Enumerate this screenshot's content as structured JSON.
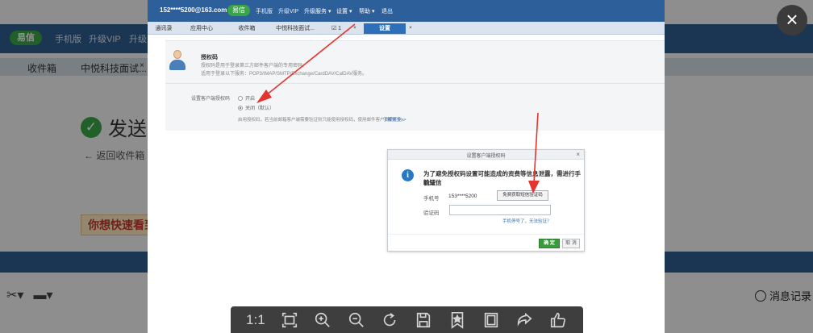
{
  "background": {
    "brand": "易信",
    "nav": [
      "手机版",
      "升级VIP",
      "升级"
    ],
    "tabs": [
      "收件箱",
      "中悦科技面试..."
    ],
    "tab_close": "×",
    "sent_title": "发送",
    "back_link": "← 返回收件箱",
    "promo": "你想快速看到",
    "message_record": "消息记录"
  },
  "viewer": {
    "close_glyph": "×",
    "toolbar": [
      {
        "name": "actual-size-button",
        "icon": "one-to-one-icon",
        "label": "1:1"
      },
      {
        "name": "fit-window-button",
        "icon": "fit-window-icon"
      },
      {
        "name": "zoom-in-button",
        "icon": "zoom-in-icon"
      },
      {
        "name": "zoom-out-button",
        "icon": "zoom-out-icon"
      },
      {
        "name": "rotate-button",
        "icon": "rotate-icon"
      },
      {
        "name": "save-button",
        "icon": "save-icon"
      },
      {
        "name": "favorite-button",
        "icon": "bookmark-star-icon"
      },
      {
        "name": "window-button",
        "icon": "frame-icon"
      },
      {
        "name": "share-button",
        "icon": "share-icon"
      },
      {
        "name": "like-button",
        "icon": "thumbs-up-icon"
      }
    ]
  },
  "image": {
    "account": "152****5200@163.com ▾",
    "brand": "易信",
    "nav": [
      "手机版",
      "升级VIP",
      "升级服务 ▾",
      "设置 ▾",
      "帮助 ▾",
      "退出"
    ],
    "tabs": [
      "通讯录",
      "应用中心",
      "收件箱",
      "中悦科技面试...",
      "☑ 1",
      "设置"
    ],
    "tab_close": "×",
    "auth": {
      "title": "授权码",
      "desc1": "授权码是用于登录第三方邮件客户端的专用密码。",
      "desc2": "适用于登录以下服务：POP3/IMAP/SMTP/Exchange/CardDAV/CalDAV服务。",
      "setting_label": "设置客户端授权码",
      "option_on": "开启",
      "option_off": "关闭（默认）",
      "note": "启用授权码，若当前邮箱客户端需要验证则只能使用授权码，使用邮件客户端更安全。",
      "more_link": "了解更多>>"
    },
    "dialog": {
      "title": "设置客户端授权码",
      "close": "×",
      "message_line1": "为了避免授权码设置可能造成的资费等信息泄露，需进行手机短信",
      "message_line2": "验证",
      "phone_label": "手机号",
      "phone_value": "153****5200",
      "get_code_button": "免费获取短信验证码",
      "code_label": "验证码",
      "code_value": "",
      "lost_phone_link": "手机停号了，无法验证？",
      "ok_button": "确 定",
      "cancel_button": "取 消"
    }
  }
}
